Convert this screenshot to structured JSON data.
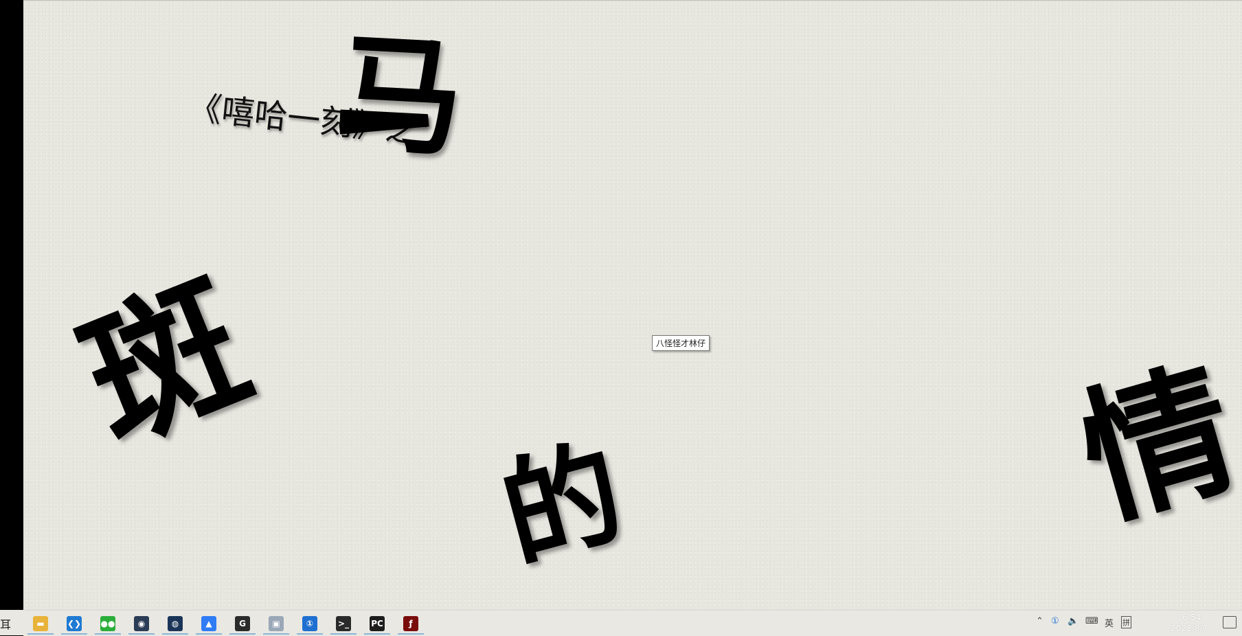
{
  "desktop": {
    "glyphs": {
      "ma": "马",
      "ban": "斑",
      "de": "的",
      "qing": "情"
    },
    "subtitle": "《嘻哈一刻》之",
    "tooltip": "八怪怪才林仔"
  },
  "left_edge_char": "耳",
  "taskbar": {
    "apps": [
      {
        "name": "file-explorer",
        "icon": "folder-icon",
        "color": "#e8b33a",
        "glyph": "▬"
      },
      {
        "name": "vscode",
        "icon": "vscode-icon",
        "color": "#1f7ad1",
        "glyph": "❮❯"
      },
      {
        "name": "wechat",
        "icon": "wechat-icon",
        "color": "#2aae3a",
        "glyph": "●●"
      },
      {
        "name": "eye-app",
        "icon": "eye-icon",
        "color": "#2b3c56",
        "glyph": "◉"
      },
      {
        "name": "steam",
        "icon": "steam-icon",
        "color": "#1b3558",
        "glyph": "◍"
      },
      {
        "name": "lark",
        "icon": "lark-icon",
        "color": "#2f7cf6",
        "glyph": "▲"
      },
      {
        "name": "g-app",
        "icon": "g-circle-icon",
        "color": "#2b2b2b",
        "glyph": "G"
      },
      {
        "name": "image-viewer",
        "icon": "image-icon",
        "color": "#9aa7b7",
        "glyph": "▣"
      },
      {
        "name": "onepassword",
        "icon": "onepassword-icon",
        "color": "#1f6fd1",
        "glyph": "①"
      },
      {
        "name": "terminal",
        "icon": "terminal-icon",
        "color": "#2a2a2a",
        "glyph": ">_"
      },
      {
        "name": "pycharm",
        "icon": "pycharm-icon",
        "color": "#1c1c1c",
        "glyph": "PC"
      },
      {
        "name": "flash",
        "icon": "flash-icon",
        "color": "#7a0b0b",
        "glyph": "ƒ"
      }
    ],
    "tray": {
      "chevron": "⌃",
      "onepassword_tray": "①",
      "volume": "🔈",
      "keyboard": "⌨",
      "lang": "英",
      "ime": "拼"
    },
    "clock": {
      "time": "16:54",
      "date": "2021/8/7"
    }
  }
}
